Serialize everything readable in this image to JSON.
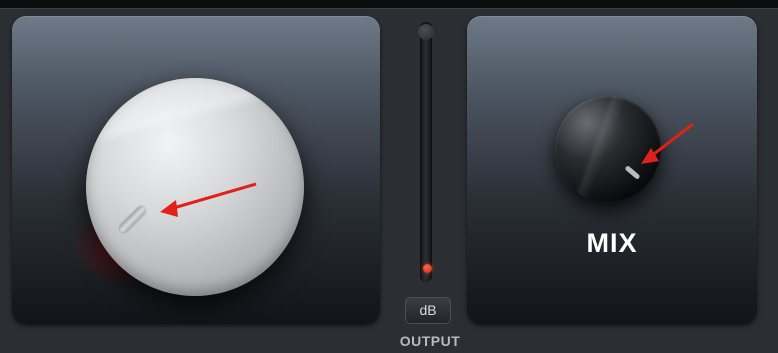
{
  "mix": {
    "label": "MIX"
  },
  "output": {
    "label": "OUTPUT",
    "unit_button": "dB"
  },
  "colors": {
    "accent_red": "#d41a1a",
    "arrow_red": "#e0201c",
    "panel_top": "#6e7a88",
    "panel_bottom": "#121418"
  }
}
